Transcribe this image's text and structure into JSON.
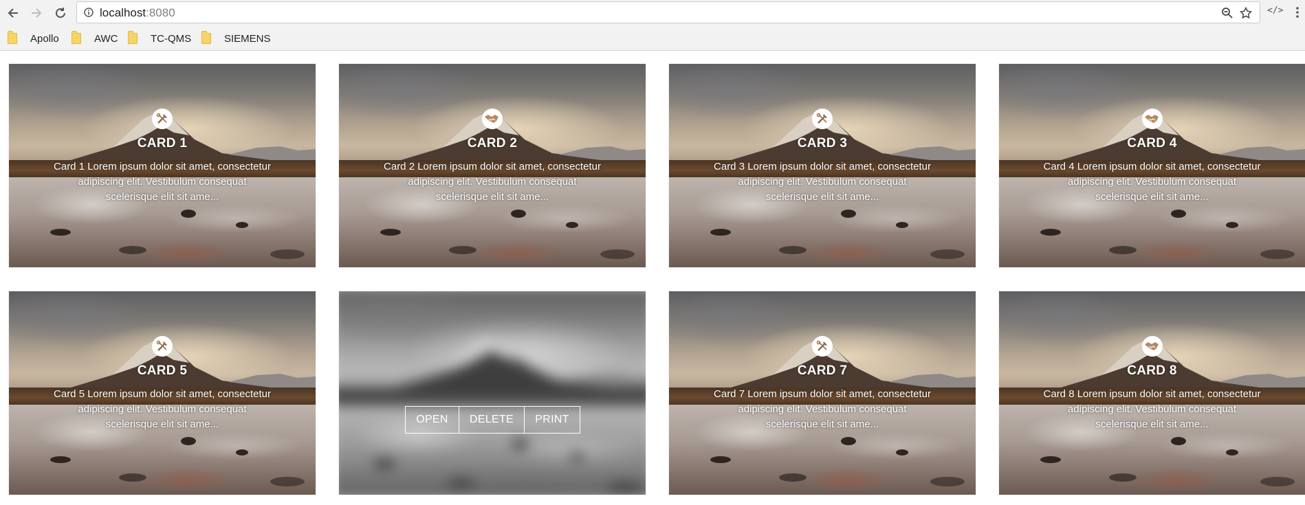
{
  "browser": {
    "url_host": "localhost",
    "url_port": ":8080",
    "icons": {
      "back": "back-arrow-icon",
      "forward": "forward-arrow-icon",
      "reload": "reload-icon",
      "info": "info-icon",
      "zoom": "zoom-icon",
      "star": "star-icon",
      "extension": "code-extension-icon",
      "menu": "menu-dots-icon"
    },
    "extension_glyph": "</>",
    "bookmarks": [
      {
        "label": "Apollo"
      },
      {
        "label": "AWC"
      },
      {
        "label": "TC-QMS"
      },
      {
        "label": "SIEMENS"
      }
    ]
  },
  "cards": [
    {
      "title": "CARD 1",
      "text": "Card 1 Lorem ipsum dolor sit amet, consectetur adipiscing elit. Vestibulum consequat scelerisque elit sit ame...",
      "icon": "tools-icon"
    },
    {
      "title": "CARD 2",
      "text": "Card 2 Lorem ipsum dolor sit amet, consectetur adipiscing elit. Vestibulum consequat scelerisque elit sit ame...",
      "icon": "handshake-icon"
    },
    {
      "title": "CARD 3",
      "text": "Card 3 Lorem ipsum dolor sit amet, consectetur adipiscing elit. Vestibulum consequat scelerisque elit sit ame...",
      "icon": "tools-icon"
    },
    {
      "title": "CARD 4",
      "text": "Card 4 Lorem ipsum dolor sit amet, consectetur adipiscing elit. Vestibulum consequat scelerisque elit sit ame...",
      "icon": "handshake-icon"
    },
    {
      "title": "CARD 5",
      "text": "Card 5 Lorem ipsum dolor sit amet, consectetur adipiscing elit. Vestibulum consequat scelerisque elit sit ame...",
      "icon": "tools-icon"
    },
    {
      "title": "",
      "text": "",
      "icon": "",
      "hovered": true,
      "actions": [
        {
          "label": "OPEN"
        },
        {
          "label": "DELETE"
        },
        {
          "label": "PRINT"
        }
      ]
    },
    {
      "title": "CARD 7",
      "text": "Card 7 Lorem ipsum dolor sit amet, consectetur adipiscing elit. Vestibulum consequat scelerisque elit sit ame...",
      "icon": "tools-icon"
    },
    {
      "title": "CARD 8",
      "text": "Card 8 Lorem ipsum dolor sit amet, consectetur adipiscing elit. Vestibulum consequat scelerisque elit sit ame...",
      "icon": "handshake-icon"
    }
  ],
  "colors": {
    "toolbar_bg": "#f2f2f2",
    "overlay_text": "#ffffff",
    "folder": "#f6d467"
  }
}
